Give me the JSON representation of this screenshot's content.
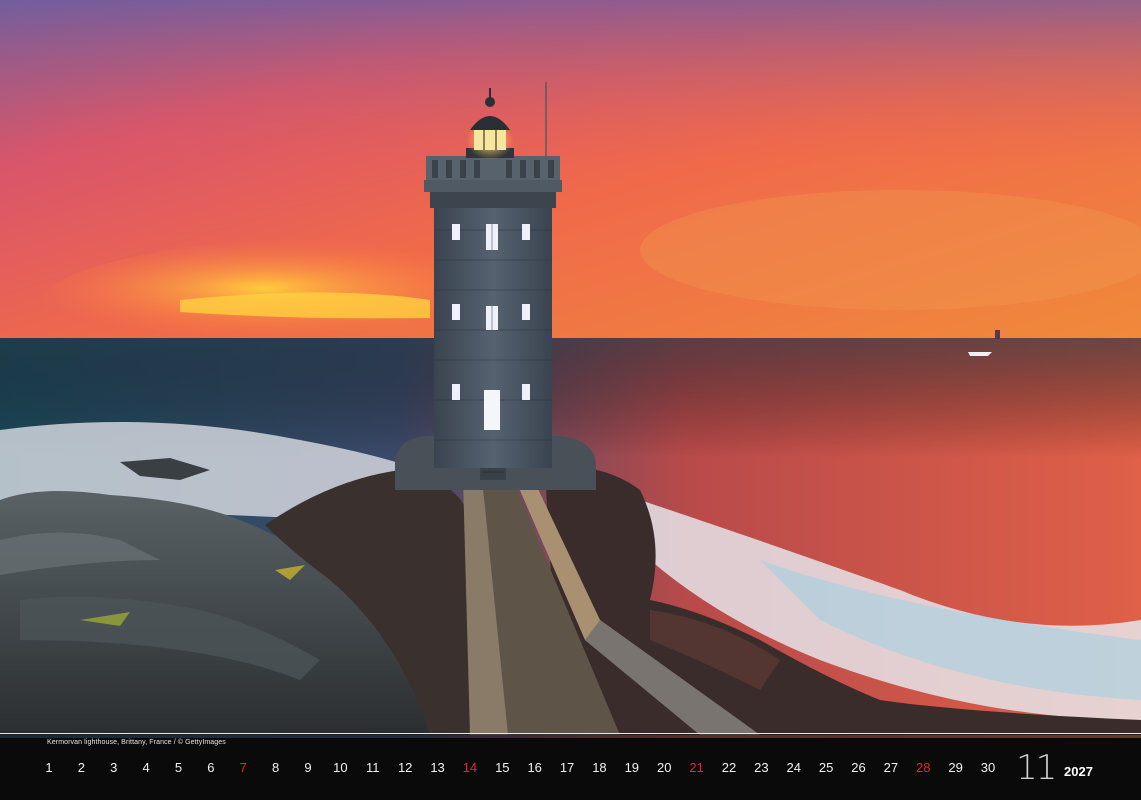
{
  "photo": {
    "caption": "Kermorvan lighthouse, Brittany, France / © GettyImages"
  },
  "calendar": {
    "month_number": "11",
    "year": "2027",
    "days": [
      {
        "label": "1",
        "sunday": false
      },
      {
        "label": "2",
        "sunday": false
      },
      {
        "label": "3",
        "sunday": false
      },
      {
        "label": "4",
        "sunday": false
      },
      {
        "label": "5",
        "sunday": false
      },
      {
        "label": "6",
        "sunday": false
      },
      {
        "label": "7",
        "sunday": true
      },
      {
        "label": "8",
        "sunday": false
      },
      {
        "label": "9",
        "sunday": false
      },
      {
        "label": "10",
        "sunday": false
      },
      {
        "label": "11",
        "sunday": false
      },
      {
        "label": "12",
        "sunday": false
      },
      {
        "label": "13",
        "sunday": false
      },
      {
        "label": "14",
        "sunday": true
      },
      {
        "label": "15",
        "sunday": false
      },
      {
        "label": "16",
        "sunday": false
      },
      {
        "label": "17",
        "sunday": false
      },
      {
        "label": "18",
        "sunday": false
      },
      {
        "label": "19",
        "sunday": false
      },
      {
        "label": "20",
        "sunday": false
      },
      {
        "label": "21",
        "sunday": true
      },
      {
        "label": "22",
        "sunday": false
      },
      {
        "label": "23",
        "sunday": false
      },
      {
        "label": "24",
        "sunday": false
      },
      {
        "label": "25",
        "sunday": false
      },
      {
        "label": "26",
        "sunday": false
      },
      {
        "label": "27",
        "sunday": false
      },
      {
        "label": "28",
        "sunday": true
      },
      {
        "label": "29",
        "sunday": false
      },
      {
        "label": "30",
        "sunday": false
      }
    ],
    "sunday_color": "#e8262f",
    "day_color": "#f2f2f2"
  }
}
